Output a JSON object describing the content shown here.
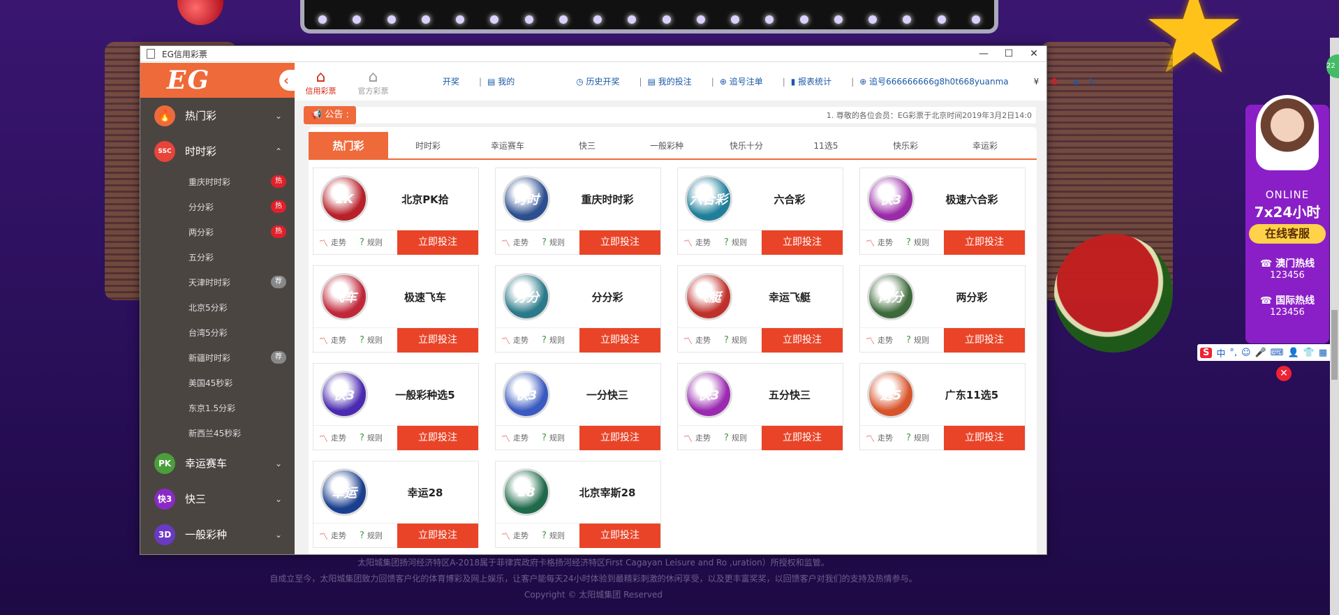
{
  "window": {
    "title": "EG信用彩票"
  },
  "sidebar": {
    "logo": "EG",
    "categories": [
      {
        "label": "热门彩",
        "icon": "flame-icon",
        "color": "#ef6a3a",
        "chev": "⌄"
      },
      {
        "label": "时时彩",
        "icon": "ssc-icon",
        "color": "#e8443a",
        "chev": "⌃"
      }
    ],
    "subitems": [
      {
        "label": "重庆时时彩",
        "badge": "热"
      },
      {
        "label": "分分彩",
        "badge": "热"
      },
      {
        "label": "两分彩",
        "badge": "热"
      },
      {
        "label": "五分彩",
        "badge": ""
      },
      {
        "label": "天津时时彩",
        "badge": "荐"
      },
      {
        "label": "北京5分彩",
        "badge": ""
      },
      {
        "label": "台湾5分彩",
        "badge": ""
      },
      {
        "label": "新疆时时彩",
        "badge": "荐"
      },
      {
        "label": "美国45秒彩",
        "badge": ""
      },
      {
        "label": "东京1.5分彩",
        "badge": ""
      },
      {
        "label": "新西兰45秒彩",
        "badge": ""
      }
    ],
    "more_categories": [
      {
        "label": "幸运赛车",
        "icon": "pk-icon",
        "badge_text": "PK",
        "color": "#4a9f3a"
      },
      {
        "label": "快三",
        "icon": "k3-icon",
        "badge_text": "快3",
        "color": "#8a2ac4"
      },
      {
        "label": "一般彩种",
        "icon": "3d-icon",
        "badge_text": "3D",
        "color": "#6a3ac4"
      }
    ]
  },
  "topnav": {
    "tabs": [
      {
        "label": "信用彩票",
        "icon": "home-icon"
      },
      {
        "label": "官方彩票",
        "icon": "home-gray-icon"
      }
    ],
    "links": [
      "开奖",
      "我的",
      "历史开奖",
      "我的投注",
      "追号注单",
      "报表统计",
      "追号666666666g8h0t668yuanma"
    ],
    "balance_symbol": "¥",
    "balance": "0"
  },
  "notice": {
    "label": "公告 :",
    "text": "1. 尊敬的各位会员：EG彩票于北京时间2019年3月2日14:0"
  },
  "lottery_tabs": [
    "热门彩",
    "时时彩",
    "幸运赛车",
    "快三",
    "一般彩种",
    "快乐十分",
    "11选5",
    "快乐彩",
    "幸运彩"
  ],
  "card_common": {
    "trend": "走势",
    "rule": "规则",
    "bet": "立即投注"
  },
  "games": [
    {
      "name": "北京PK拾",
      "badge": "1K",
      "color": "#b8202a"
    },
    {
      "name": "重庆时时彩",
      "badge": "时时",
      "color": "#2c4f8f"
    },
    {
      "name": "六合彩",
      "badge": "六合彩",
      "color": "#1f7f9b"
    },
    {
      "name": "极速六合彩",
      "badge": "快3",
      "color": "#9a2aa8"
    },
    {
      "name": "极速飞车",
      "badge": "飞车",
      "color": "#c0283a"
    },
    {
      "name": "分分彩",
      "badge": "分分",
      "color": "#2a7a8a"
    },
    {
      "name": "幸运飞艇",
      "badge": "飞艇",
      "color": "#c0302a"
    },
    {
      "name": "两分彩",
      "badge": "两分",
      "color": "#3d6a3a"
    },
    {
      "name": "一般彩种选5",
      "badge": "快3",
      "color": "#4a2ab0"
    },
    {
      "name": "一分快三",
      "badge": "快3",
      "color": "#3a5ac0"
    },
    {
      "name": "五分快三",
      "badge": "快3",
      "color": "#9a2ab0"
    },
    {
      "name": "广东11选5",
      "badge": "选5",
      "color": "#d8532a"
    },
    {
      "name": "幸运28",
      "badge": "幸运",
      "color": "#1a3f8f"
    },
    {
      "name": "北京宰斯28",
      "badge": "28",
      "color": "#1f6a4a"
    }
  ],
  "footer": {
    "line1": "太阳城集团扬河经济特区A-2018属于菲律宾政府卡格扬河经济特区First Cagayan Leisure and Ro        ,uration）所授权和监管。",
    "line2": "自成立至今，太阳城集团致力回馈客户化的体育博彩及网上娱乐，让客户能每天24小时体验到最精彩刺激的休闲享受，以及更丰富奖奖，以回馈客户对我们的支持及热情参与。",
    "line3": "Copyright © 太阳城集团 Reserved"
  },
  "chat": {
    "online": "ONLINE",
    "hours": "7x24小时",
    "service": "在线客服",
    "macau_label": "澳门热线",
    "macau_num": "123456",
    "intl_label": "国际热线",
    "intl_num": "123456"
  },
  "ime": {
    "logo": "S",
    "items": [
      "中",
      "°,",
      "☺",
      "🎤",
      "⌨",
      "👤",
      "👕",
      "▦"
    ]
  },
  "side_pill": "22"
}
